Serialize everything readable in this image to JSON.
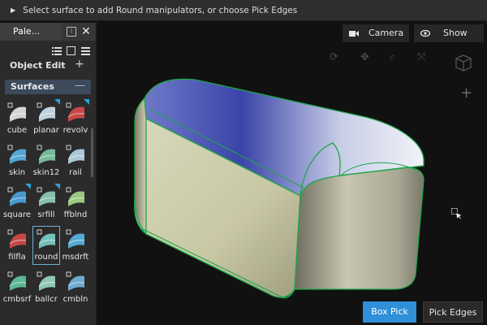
{
  "hint": {
    "text": "Select surface to add Round manipulators, or choose Pick Edges"
  },
  "palette": {
    "tab_label": "Pale...",
    "object_edit_label": "Object Edit",
    "surfaces_label": "Surfaces",
    "tools": [
      {
        "label": "cube",
        "icon": "cube-icon"
      },
      {
        "label": "planar",
        "icon": "planar-icon"
      },
      {
        "label": "revolv",
        "icon": "revolve-icon"
      },
      {
        "label": "skin",
        "icon": "skin-icon"
      },
      {
        "label": "skin12",
        "icon": "skin12-icon"
      },
      {
        "label": "rail",
        "icon": "rail-icon"
      },
      {
        "label": "square",
        "icon": "square-icon"
      },
      {
        "label": "srfill",
        "icon": "srfill-icon"
      },
      {
        "label": "ffblnd",
        "icon": "ffblnd-icon"
      },
      {
        "label": "filfla",
        "icon": "filfla-icon"
      },
      {
        "label": "round",
        "icon": "round-icon",
        "selected": true
      },
      {
        "label": "msdrft",
        "icon": "msdrft-icon"
      },
      {
        "label": "cmbsrf",
        "icon": "cmbsrf-icon"
      },
      {
        "label": "ballcr",
        "icon": "ballcr-icon"
      },
      {
        "label": "cmbln",
        "icon": "cmbln-icon"
      }
    ]
  },
  "viewport": {
    "camera_label": "Camera",
    "show_label": "Show",
    "box_pick_label": "Box Pick",
    "pick_edges_label": "Pick Edges"
  },
  "colors": {
    "accent": "#2f8fd8",
    "edge": "#1ea64a",
    "panel": "#2b2b2b",
    "viewport": "#111111"
  }
}
